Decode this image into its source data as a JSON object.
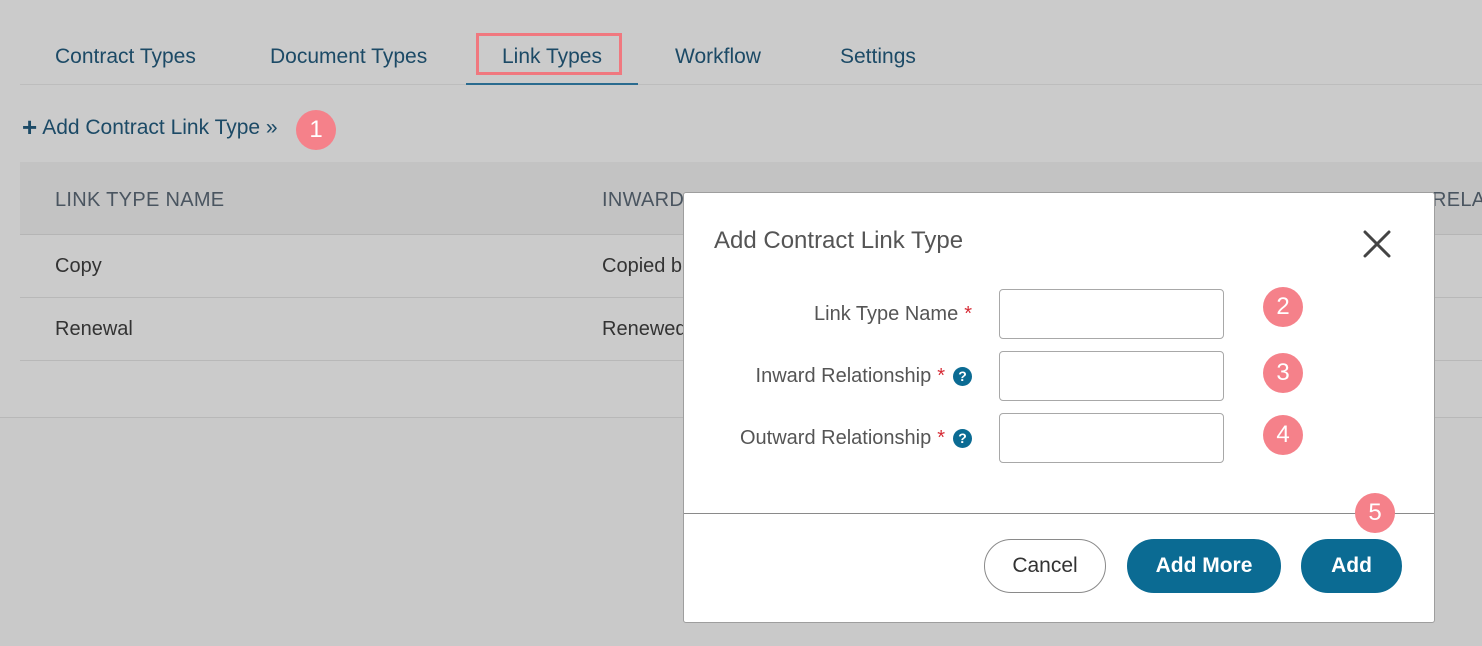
{
  "tabs": [
    {
      "label": "Contract Types"
    },
    {
      "label": "Document Types"
    },
    {
      "label": "Link Types"
    },
    {
      "label": "Workflow"
    },
    {
      "label": "Settings"
    }
  ],
  "active_tab": "Link Types",
  "add_link": {
    "icon": "plus-icon",
    "label": "Add Contract Link Type »"
  },
  "table": {
    "headers": [
      "LINK TYPE NAME",
      "INWARD",
      "RELA"
    ],
    "rows": [
      {
        "name": "Copy",
        "inward": "Copied b"
      },
      {
        "name": "Renewal",
        "inward": "Renewed"
      }
    ]
  },
  "modal": {
    "title": "Add Contract Link Type",
    "close_icon": "close-icon",
    "fields": [
      {
        "label": "Link Type Name",
        "required": "*",
        "value": "",
        "help": false
      },
      {
        "label": "Inward Relationship",
        "required": "*",
        "value": "",
        "help": true
      },
      {
        "label": "Outward Relationship",
        "required": "*",
        "value": "",
        "help": true
      }
    ],
    "help_glyph": "?",
    "buttons": {
      "cancel": "Cancel",
      "add_more": "Add More",
      "add": "Add"
    }
  },
  "badges": [
    "1",
    "2",
    "3",
    "4",
    "5"
  ],
  "colors": {
    "badge": "#f5818a",
    "primary": "#0b6b93",
    "tab_text": "#1c4a66",
    "required": "#d62b35",
    "highlight": "#f0787f"
  }
}
